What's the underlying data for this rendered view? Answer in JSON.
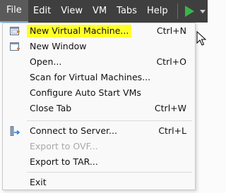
{
  "menubar": {
    "items": [
      {
        "label": "File"
      },
      {
        "label": "Edit"
      },
      {
        "label": "View"
      },
      {
        "label": "VM"
      },
      {
        "label": "Tabs"
      },
      {
        "label": "Help"
      }
    ],
    "play_icon": "play-icon",
    "dropdown_icon": "chevron-down-icon"
  },
  "file_menu": {
    "items": [
      {
        "label": "New Virtual Machine...",
        "shortcut": "Ctrl+N",
        "icon": "new-vm-icon",
        "enabled": true,
        "highlighted": true
      },
      {
        "label": "New Window",
        "shortcut": "",
        "icon": "new-window-icon",
        "enabled": true
      },
      {
        "label": "Open...",
        "shortcut": "Ctrl+O",
        "icon": "",
        "enabled": true
      },
      {
        "label": "Scan for Virtual Machines...",
        "shortcut": "",
        "icon": "",
        "enabled": true
      },
      {
        "label": "Configure Auto Start VMs",
        "shortcut": "",
        "icon": "",
        "enabled": true
      },
      {
        "label": "Close Tab",
        "shortcut": "Ctrl+W",
        "icon": "",
        "enabled": true
      },
      {
        "label": "Connect to Server...",
        "shortcut": "Ctrl+L",
        "icon": "connect-server-icon",
        "enabled": true
      },
      {
        "label": "Export to OVF...",
        "shortcut": "",
        "icon": "",
        "enabled": false
      },
      {
        "label": "Export to TAR...",
        "shortcut": "",
        "icon": "",
        "enabled": true
      },
      {
        "label": "Exit",
        "shortcut": "",
        "icon": "",
        "enabled": true
      }
    ]
  },
  "colors": {
    "menubar_bg": "#3f3f3f",
    "menu_bg": "#f9f9f9",
    "highlight": "#ffff2a",
    "play_green": "#39b54a",
    "active_underline": "#6aa7e6"
  }
}
